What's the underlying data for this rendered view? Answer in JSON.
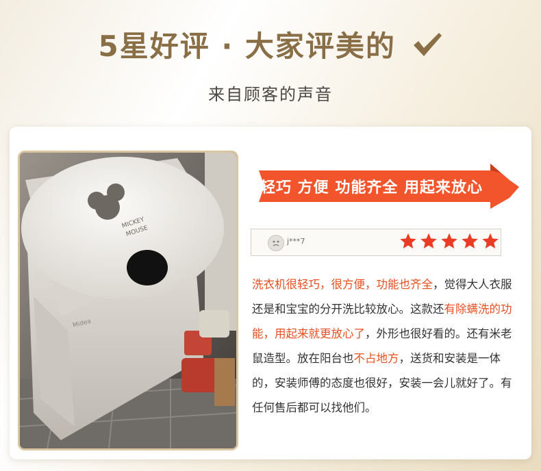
{
  "header": {
    "title": "5星好评 · 大家评美的",
    "check_icon": "check-icon",
    "subtitle": "来自顾客的声音"
  },
  "colors": {
    "title": "#8a6e46",
    "banner": "#f2542c",
    "highlight": "#e84f22",
    "star": "#ea3b24"
  },
  "banner": {
    "text": "轻巧 方便 功能齐全 用起来放心"
  },
  "review": {
    "avatar_icon": "face-avatar-icon",
    "username": "j***7",
    "rating": 5,
    "rating_max": 5,
    "segments": [
      {
        "text": "洗衣机很轻巧，很方便，功能也齐全",
        "highlight": true
      },
      {
        "text": "，觉得大人衣服还是和宝宝的分开洗比较放心。这款还",
        "highlight": false
      },
      {
        "text": "有除螨洗的功能，用起来就更放心了",
        "highlight": true
      },
      {
        "text": "，外形也很好看的。还有米老鼠造型。放在阳台也",
        "highlight": false
      },
      {
        "text": "不占地方",
        "highlight": true
      },
      {
        "text": "，送货和安装是一体的，安装师傅的态度也很好，安装一会儿就好了。有任何售后都可以找他们。",
        "highlight": false
      }
    ]
  },
  "photo": {
    "lid_logo_line1": "MICKEY",
    "lid_logo_line2": "MOUSE",
    "brand": "Midea"
  }
}
